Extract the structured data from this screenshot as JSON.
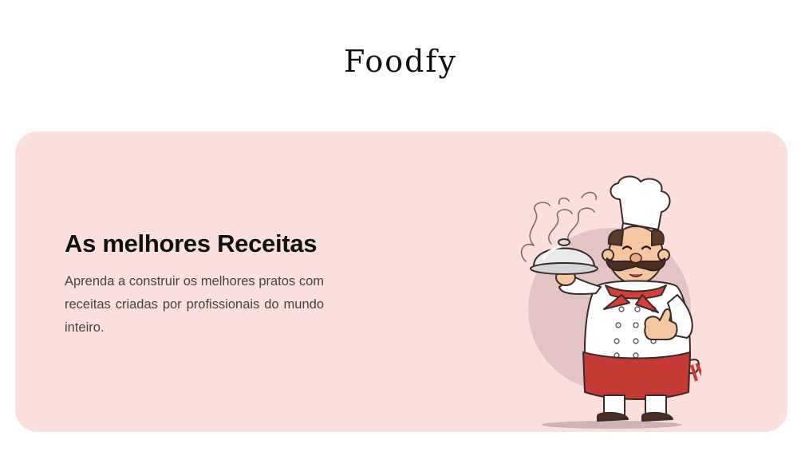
{
  "header": {
    "logo": "Foodfy"
  },
  "hero": {
    "title": "As melhores Receitas",
    "description": "Aprenda a construir os melhores pratos com receitas criadas por profissionais do mundo inteiro.",
    "illustration_icon": "chef-holding-cloche-icon"
  },
  "colors": {
    "hero_background": "#fbdfdc",
    "title_text": "#111111",
    "body_text": "#444444",
    "accent_red": "#d2403a"
  }
}
